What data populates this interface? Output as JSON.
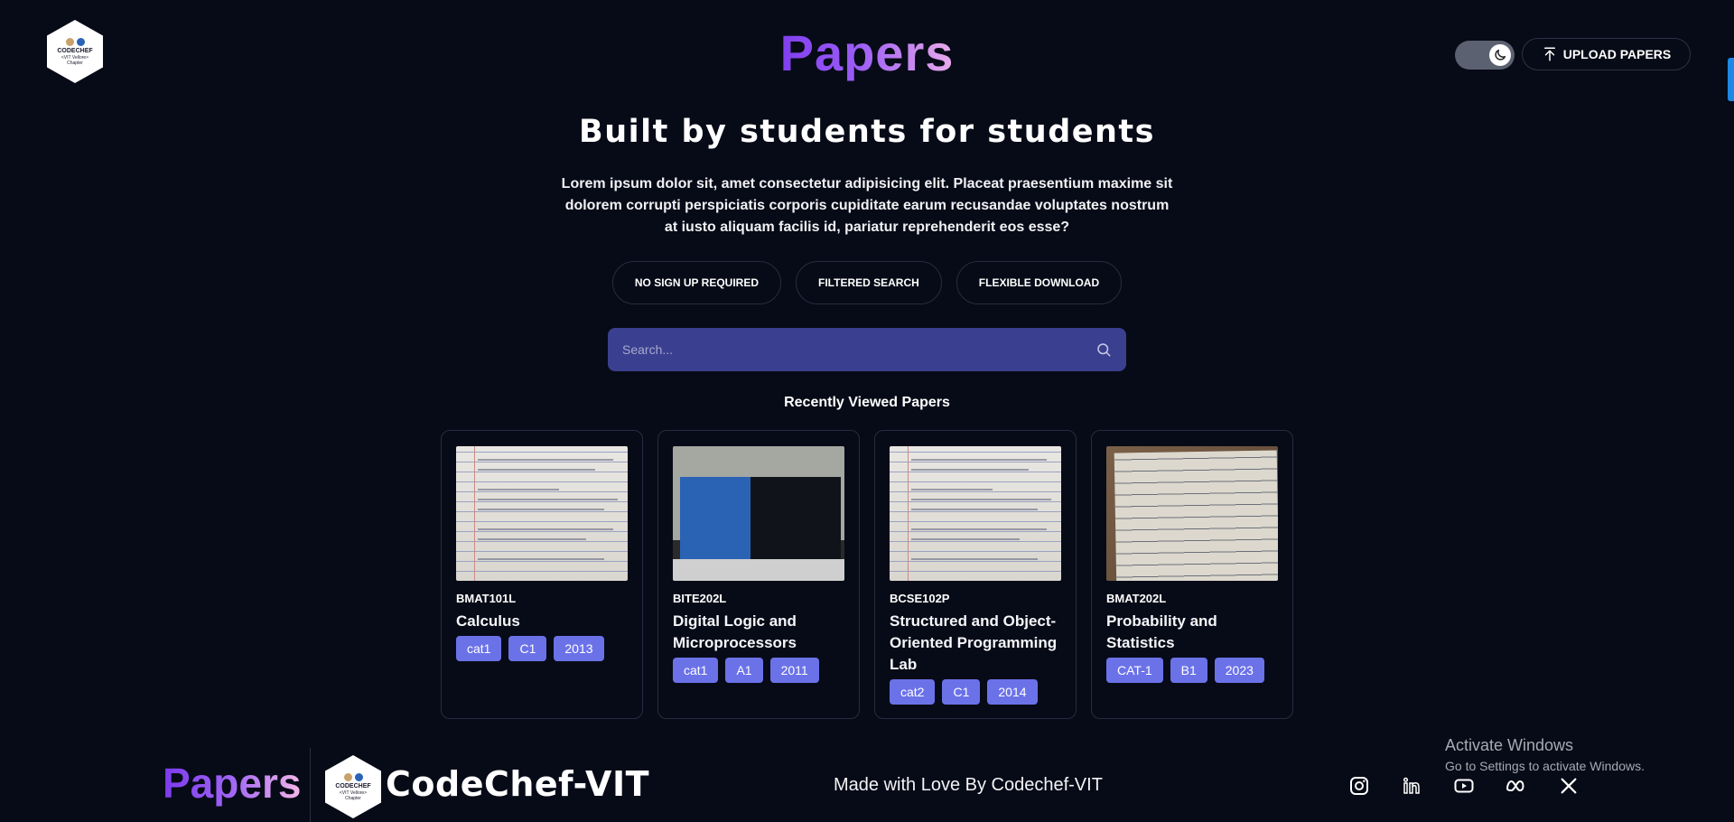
{
  "logo": {
    "line1": "CODECHEF",
    "line2": "<VIT Vellore>",
    "line3": "Chapter"
  },
  "header": {
    "title": "Papers",
    "upload_label": "UPLOAD PAPERS"
  },
  "hero": {
    "headline": "Built by students for students",
    "lead": "Lorem ipsum dolor sit, amet consectetur adipisicing elit. Placeat praesentium maxime sit dolorem corrupti perspiciatis corporis cupiditate earum recusandae voluptates nostrum at iusto aliquam facilis id, pariatur reprehenderit eos esse?",
    "features": [
      "NO SIGN UP REQUIRED",
      "FILTERED SEARCH",
      "FLEXIBLE DOWNLOAD"
    ]
  },
  "search": {
    "placeholder": "Search..."
  },
  "recent": {
    "title": "Recently Viewed Papers",
    "cards": [
      {
        "code": "BMAT101L",
        "subject": "Calculus",
        "tags": [
          "cat1",
          "C1",
          "2013"
        ]
      },
      {
        "code": "BITE202L",
        "subject": "Digital Logic and Microprocessors",
        "tags": [
          "cat1",
          "A1",
          "2011"
        ]
      },
      {
        "code": "BCSE102P",
        "subject": "Structured and Object-Oriented Programming Lab",
        "tags": [
          "cat2",
          "C1",
          "2014"
        ]
      },
      {
        "code": "BMAT202L",
        "subject": "Probability and Statistics",
        "tags": [
          "CAT-1",
          "B1",
          "2023"
        ]
      }
    ]
  },
  "footer": {
    "brand": "Papers",
    "org": "CodeChef-VIT",
    "made_with": "Made with Love By Codechef-VIT",
    "socials": [
      "instagram-icon",
      "linkedin-icon",
      "youtube-icon",
      "meta-icon",
      "x-icon"
    ]
  },
  "watermark": {
    "title": "Activate Windows",
    "subtitle": "Go to Settings to activate Windows."
  },
  "colors": {
    "background": "#070b17",
    "accent": "#6b72e8",
    "search_bg": "#3b3f8f",
    "brand_start": "#7c3aed",
    "brand_end": "#f3b6e8"
  }
}
